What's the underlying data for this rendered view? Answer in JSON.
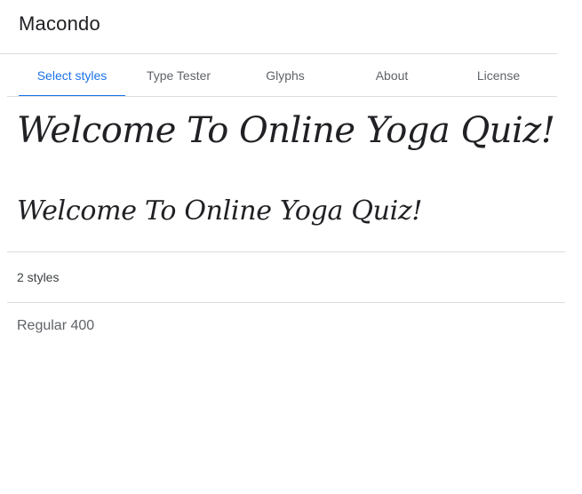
{
  "header": {
    "font_name": "Macondo"
  },
  "tabs": [
    {
      "label": "Select styles",
      "active": true
    },
    {
      "label": "Type Tester",
      "active": false
    },
    {
      "label": "Glyphs",
      "active": false
    },
    {
      "label": "About",
      "active": false
    },
    {
      "label": "License",
      "active": false
    }
  ],
  "samples": {
    "large_text": "Welcome To Online Yoga Quiz!",
    "medium_text": "Welcome To Online Yoga Quiz!"
  },
  "styles": {
    "count_label": "2 styles",
    "items": [
      {
        "label": "Regular 400"
      }
    ]
  },
  "colors": {
    "accent": "#1a73e8",
    "text": "#202124",
    "muted": "#5f6368",
    "divider": "#dadce0"
  }
}
